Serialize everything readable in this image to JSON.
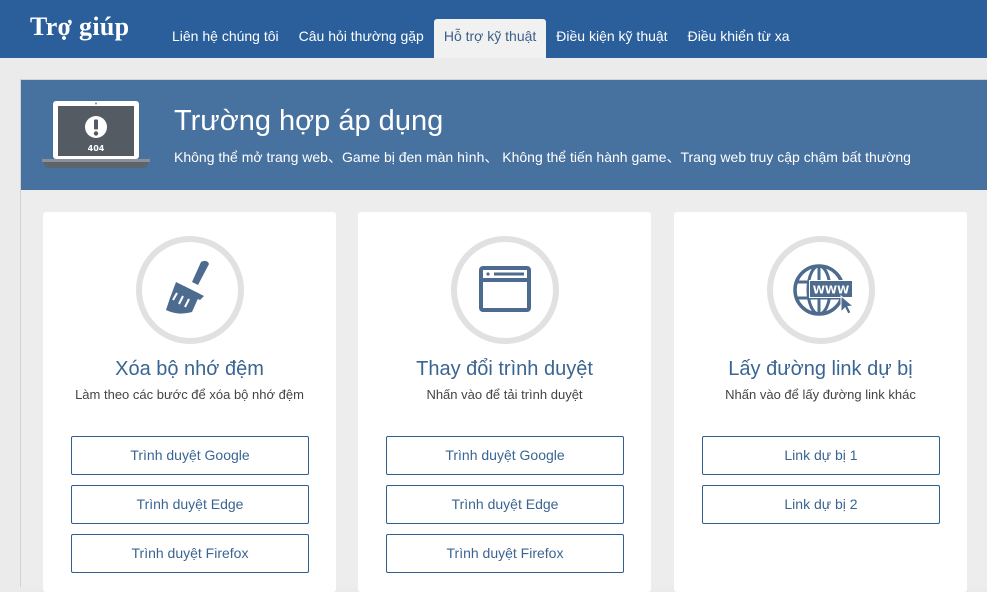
{
  "header": {
    "brand": "Trợ giúp",
    "nav": [
      {
        "label": "Liên hệ chúng tôi",
        "active": false
      },
      {
        "label": "Câu hỏi thường gặp",
        "active": false
      },
      {
        "label": "Hỗ trợ kỹ thuật",
        "active": true
      },
      {
        "label": "Điều kiện kỹ thuật",
        "active": false
      },
      {
        "label": "Điều khiển từ xa",
        "active": false
      }
    ]
  },
  "banner": {
    "screen_code": "404",
    "title": "Trường hợp áp dụng",
    "subtitle": "Không thể mở trang web、Game bị đen màn hình、 Không thể tiến hành game、Trang web truy cập chậm bất thường"
  },
  "cards": [
    {
      "icon": "broom-icon",
      "title": "Xóa bộ nhớ đệm",
      "desc": "Làm theo các bước để xóa bộ nhớ đệm",
      "buttons": [
        "Trình duyệt Google",
        "Trình duyệt Edge",
        "Trình duyệt Firefox"
      ]
    },
    {
      "icon": "browser-window-icon",
      "title": "Thay đổi trình duyệt",
      "desc": "Nhấn vào để tải trình duyệt",
      "buttons": [
        "Trình duyệt Google",
        "Trình duyệt Edge",
        "Trình duyệt Firefox"
      ]
    },
    {
      "icon": "www-globe-icon",
      "globe_text": "WWW",
      "title": "Lấy đường link dự bị",
      "desc": "Nhấn vào để lấy đường link khác",
      "buttons": [
        "Link dự bị 1",
        "Link dự bị 2"
      ]
    }
  ],
  "colors": {
    "header_bg": "#2a5f9b",
    "banner_bg": "#47719e",
    "accent": "#3a6592",
    "icon_fill": "#4d6b8e",
    "icon_ring": "#e1e1e1"
  }
}
